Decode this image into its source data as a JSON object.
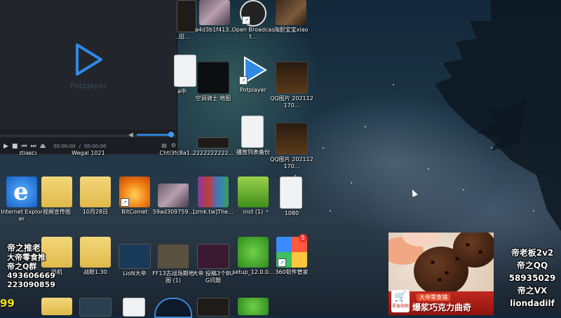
{
  "player": {
    "logo_text": "Potplayer",
    "time_current": "00:00:00",
    "time_total": "00:00:00",
    "volume": 1.0,
    "progress": 0.0
  },
  "desktop": {
    "icons": [
      {
        "id": "obs",
        "label": "Open Broadcast...",
        "kind": "obs"
      },
      {
        "id": "haixiu",
        "label": "海胆宝宝xiao",
        "kind": "thumb-game"
      },
      {
        "id": "a4d",
        "label": "a4d3b1f413...",
        "kind": "thumb-photo"
      },
      {
        "id": "top-left-partial",
        "label": "...旧...",
        "kind": "thumb-dark"
      },
      {
        "id": "kongdong",
        "label": "空洞骑士 地图",
        "kind": "thumb-starmap"
      },
      {
        "id": "potplayer",
        "label": "Potplayer",
        "kind": "potplayer"
      },
      {
        "id": "qq1",
        "label": "QQ图片 202112170...",
        "kind": "thumb-qq"
      },
      {
        "id": "bofang",
        "label": "播放列表备份",
        "kind": "file"
      },
      {
        "id": "qq2",
        "label": "QQ图片 202112170...",
        "kind": "thumb-qq"
      },
      {
        "id": "ie",
        "label": "Internet Explorer",
        "kind": "ie"
      },
      {
        "id": "shipin",
        "label": "视频宣传图",
        "kind": "folder"
      },
      {
        "id": "oct28",
        "label": "10月28日",
        "kind": "folder"
      },
      {
        "id": "bitcomet",
        "label": "BitComet",
        "kind": "bitcomet"
      },
      {
        "id": "f59",
        "label": "59ad309759...",
        "kind": "thumb-photo"
      },
      {
        "id": "zmk",
        "label": "[zmk.tw]The...",
        "kind": "winrar"
      },
      {
        "id": "inst",
        "label": "inst (1)",
        "kind": "inst"
      },
      {
        "id": "f1080",
        "label": "1080",
        "kind": "file"
      },
      {
        "id": "zhuangji",
        "label": "装机",
        "kind": "folder"
      },
      {
        "id": "zhanji",
        "label": "战眼1.30",
        "kind": "folder"
      },
      {
        "id": "lion",
        "label": "LioN大帝",
        "kind": "thumb-dark"
      },
      {
        "id": "ff13",
        "label": "FF13古战场期地图 (1)",
        "kind": "thumb-starmap"
      },
      {
        "id": "dadi",
        "label": "大帝 投稿3个BUG问题",
        "kind": "thumb-dark"
      },
      {
        "id": "setup",
        "label": "setup_12.0.0...",
        "kind": "setup"
      },
      {
        "id": "s360",
        "label": "360软件管家",
        "kind": "s360"
      },
      {
        "id": "partial1",
        "label": "",
        "kind": "partial"
      },
      {
        "id": "partial2",
        "label": "Wegal 1021",
        "kind": "partial"
      },
      {
        "id": "partial3",
        "label": "Chtl3fc8a1...",
        "kind": "partial"
      },
      {
        "id": "partial4",
        "label": "2222222222...",
        "kind": "thumb-dark"
      }
    ],
    "qq_badge": "5"
  },
  "overlay": {
    "left_lines": [
      "帝之推老",
      "大帝零食推",
      "帝之Q群",
      "493606669",
      "223090859"
    ],
    "score": "99",
    "right_lines": [
      "帝老板2v2",
      "帝之QQ",
      "58935029",
      "帝之VX",
      "liondadilf"
    ]
  },
  "ad": {
    "shop_label": "大帝零食铺",
    "shop_badge": "零食购物",
    "slogan": "爆浆巧克力曲奇"
  }
}
